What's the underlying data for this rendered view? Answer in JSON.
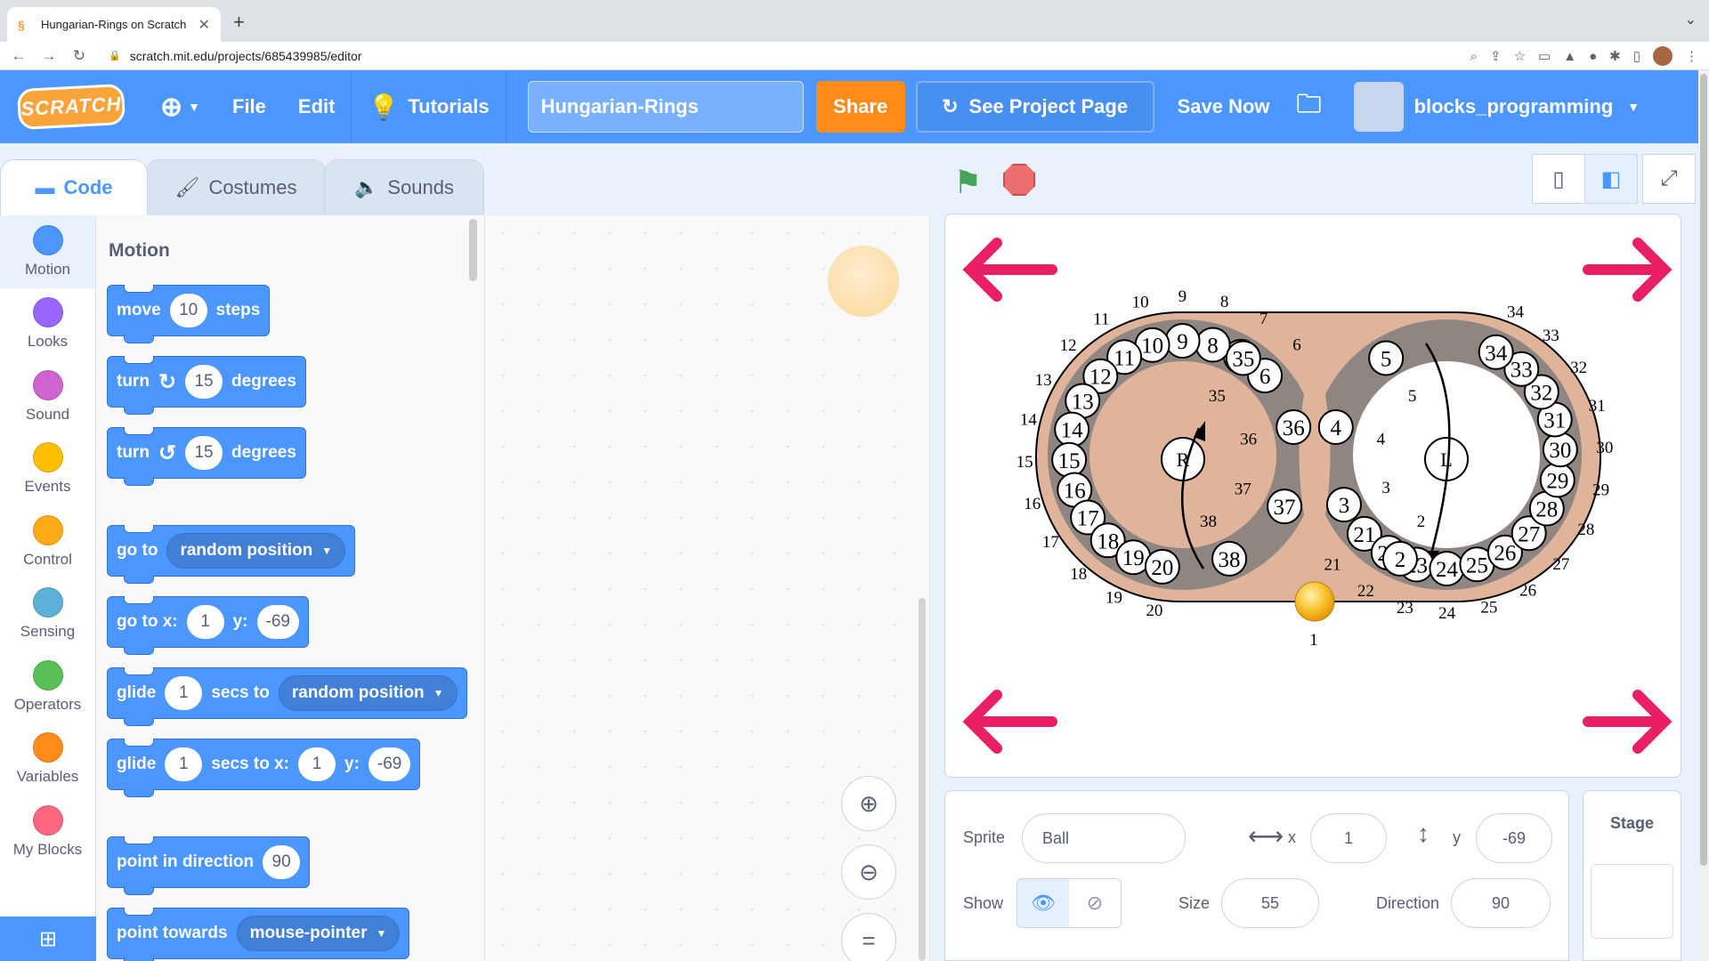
{
  "browser": {
    "tab_title": "Hungarian-Rings on Scratch",
    "url": "scratch.mit.edu/projects/685439985/editor",
    "new_tab": "+",
    "close": "✕"
  },
  "menubar": {
    "logo": "SCRATCH",
    "file": "File",
    "edit": "Edit",
    "tutorials": "Tutorials",
    "project_title": "Hungarian-Rings",
    "share": "Share",
    "see_project_page": "See Project Page",
    "save_now": "Save Now",
    "username": "blocks_programming",
    "accent_color": "#4c97ff",
    "share_color": "#ff8c1a"
  },
  "editor_tabs": [
    "Code",
    "Costumes",
    "Sounds"
  ],
  "categories": [
    {
      "label": "Motion",
      "color": "#4c97ff"
    },
    {
      "label": "Looks",
      "color": "#9966ff"
    },
    {
      "label": "Sound",
      "color": "#cf63cf"
    },
    {
      "label": "Events",
      "color": "#ffbf00"
    },
    {
      "label": "Control",
      "color": "#ffab19"
    },
    {
      "label": "Sensing",
      "color": "#5cb1d6"
    },
    {
      "label": "Operators",
      "color": "#59c059"
    },
    {
      "label": "Variables",
      "color": "#ff8c1a"
    },
    {
      "label": "My Blocks",
      "color": "#ff6680"
    }
  ],
  "palette": {
    "heading": "Motion",
    "move": {
      "a": "move",
      "v": "10",
      "b": "steps"
    },
    "turn_cw": {
      "a": "turn",
      "v": "15",
      "b": "degrees"
    },
    "turn_ccw": {
      "a": "turn",
      "v": "15",
      "b": "degrees"
    },
    "goto": {
      "a": "go to",
      "dd": "random position"
    },
    "goto_xy": {
      "a": "go to x:",
      "x": "1",
      "b": "y:",
      "y": "-69"
    },
    "glide_to": {
      "a": "glide",
      "v": "1",
      "b": "secs to",
      "dd": "random position"
    },
    "glide_xy": {
      "a": "glide",
      "v": "1",
      "b": "secs to x:",
      "x": "1",
      "c": "y:",
      "y": "-69"
    },
    "point_dir": {
      "a": "point in direction",
      "v": "90"
    },
    "point_towards": {
      "a": "point towards",
      "dd": "mouse-pointer"
    }
  },
  "stage": {
    "left_ring_label": "R",
    "right_ring_label": "L",
    "outer_color": "#dfb49b",
    "ring_color": "#8f8682",
    "arrow_color": "#e91e63",
    "ball_number_1": "1"
  },
  "sprite_info": {
    "sprite_label": "Sprite",
    "sprite_name": "Ball",
    "x_label": "x",
    "x": "1",
    "y_label": "y",
    "y": "-69",
    "show_label": "Show",
    "size_label": "Size",
    "size": "55",
    "direction_label": "Direction",
    "direction": "90"
  },
  "stage_target": {
    "label": "Stage"
  }
}
